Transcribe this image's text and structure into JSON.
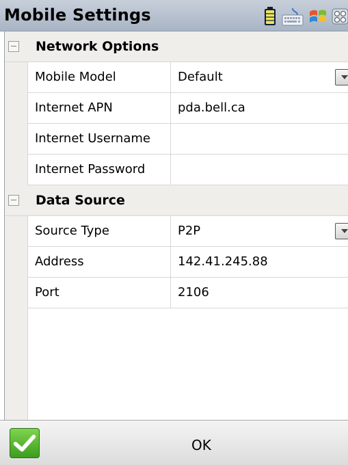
{
  "window": {
    "title": "Mobile Settings",
    "tray_icons": [
      "battery-icon",
      "keyboard-icon",
      "windows-flag-icon",
      "app-grid-icon"
    ]
  },
  "grid": {
    "sections": [
      {
        "label": "Network Options",
        "rows": [
          {
            "name": "Mobile Model",
            "value": "Default",
            "control": "dropdown"
          },
          {
            "name": "Internet APN",
            "value": "pda.bell.ca",
            "control": "text"
          },
          {
            "name": "Internet Username",
            "value": "",
            "control": "text"
          },
          {
            "name": "Internet Password",
            "value": "",
            "control": "text"
          }
        ]
      },
      {
        "label": "Data Source",
        "rows": [
          {
            "name": "Source Type",
            "value": "P2P",
            "control": "dropdown"
          },
          {
            "name": "Address",
            "value": "142.41.245.88",
            "control": "text"
          },
          {
            "name": "Port",
            "value": "2106",
            "control": "text"
          }
        ]
      }
    ]
  },
  "footer": {
    "ok_label": "OK"
  },
  "colors": {
    "title_bar": "#b7c1cf",
    "section_bg": "#efeeea",
    "ok_green": "#4caf2a"
  }
}
